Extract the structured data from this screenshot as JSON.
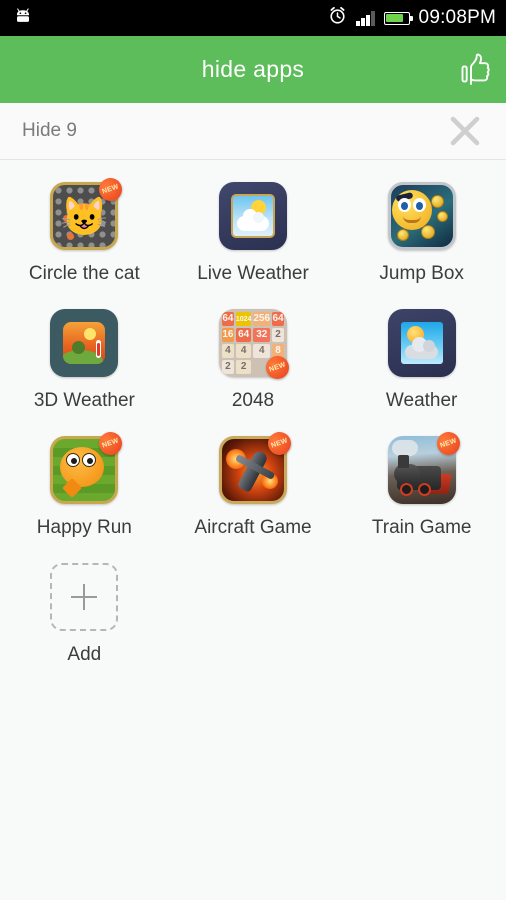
{
  "status_bar": {
    "notification_icon": "android-robot-icon",
    "alarm_icon": "alarm-clock-icon",
    "signal_icon": "signal-bars-icon",
    "battery_icon": "battery-icon",
    "time": "09:08PM"
  },
  "header": {
    "title": "hide apps",
    "action_icon": "thumbs-up-icon",
    "background_color": "#5dbd5a"
  },
  "subheader": {
    "label": "Hide 9",
    "close_icon": "close-x-icon"
  },
  "apps": [
    {
      "label": "Circle the cat",
      "icon": "circle-the-cat-icon",
      "badge": "NEW"
    },
    {
      "label": "Live Weather",
      "icon": "live-weather-icon",
      "badge": ""
    },
    {
      "label": "Jump Box",
      "icon": "jump-box-icon",
      "badge": ""
    },
    {
      "label": "3D Weather",
      "icon": "3d-weather-icon",
      "badge": ""
    },
    {
      "label": "2048",
      "icon": "2048-icon",
      "badge": "NEW"
    },
    {
      "label": "Weather",
      "icon": "weather-icon",
      "badge": ""
    },
    {
      "label": "Happy Run",
      "icon": "happy-run-icon",
      "badge": "NEW"
    },
    {
      "label": "Aircraft Game",
      "icon": "aircraft-game-icon",
      "badge": "NEW"
    },
    {
      "label": "Train Game",
      "icon": "train-game-icon",
      "badge": "NEW"
    }
  ],
  "add_tile": {
    "label": "Add",
    "icon": "plus-icon"
  },
  "game_2048_tiles": [
    "64",
    "1024",
    "256",
    "64",
    "16",
    "64",
    "32",
    "2",
    "4",
    "4",
    "4",
    "8",
    "2",
    "2",
    "",
    ""
  ],
  "colors": {
    "header_green": "#5dbd5a",
    "page_background": "#f8f9f9",
    "label_text": "#3c3c3c",
    "subheader_text": "#7b7b7b",
    "badge_red": "#e8401c"
  }
}
